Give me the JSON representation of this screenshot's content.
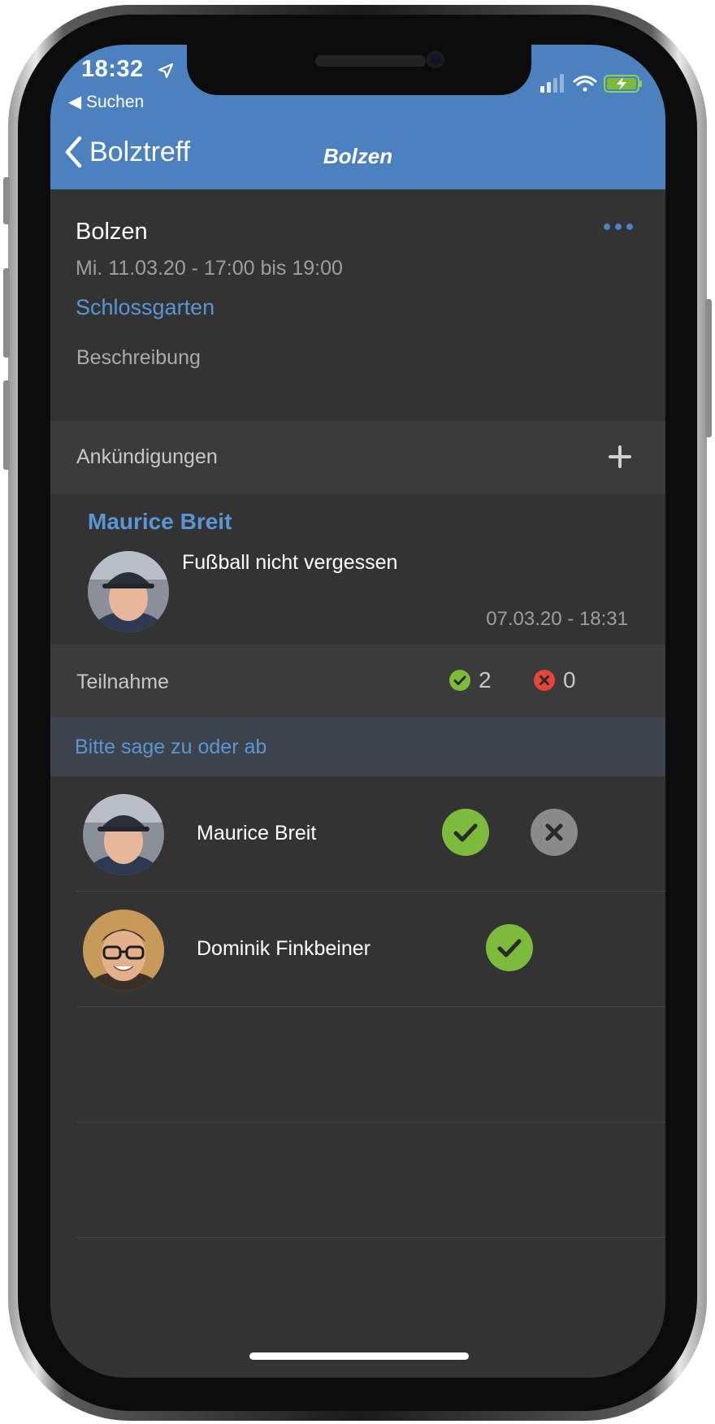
{
  "status_bar": {
    "time": "18:32",
    "back_app": "◀ Suchen"
  },
  "nav": {
    "back_label": "Bolztreff",
    "title": "Bolzen"
  },
  "event": {
    "title": "Bolzen",
    "datetime": "Mi. 11.03.20 - 17:00 bis 19:00",
    "location": "Schlossgarten",
    "description_label": "Beschreibung"
  },
  "announcements": {
    "header": "Ankündigungen",
    "items": [
      {
        "author": "Maurice Breit",
        "text": "Fußball nicht vergessen",
        "time": "07.03.20 - 18:31"
      }
    ]
  },
  "participation": {
    "header": "Teilnahme",
    "accepted_count": "2",
    "declined_count": "0",
    "prompt": "Bitte sage zu oder ab",
    "members": [
      {
        "name": "Maurice Breit",
        "status": "accepted"
      },
      {
        "name": "Dominik Finkbeiner",
        "status": "accepted"
      }
    ]
  },
  "colors": {
    "header_blue": "#4b81be",
    "accent_blue": "#5a96d4",
    "accept_green": "#7cbb3c",
    "decline_red": "#e5463c",
    "background": "#333333"
  },
  "icons": [
    "location-arrow-icon",
    "signal-icon",
    "wifi-icon",
    "battery-charging-icon",
    "chevron-left-icon",
    "more-dots-icon",
    "plus-icon",
    "check-icon",
    "close-icon"
  ]
}
